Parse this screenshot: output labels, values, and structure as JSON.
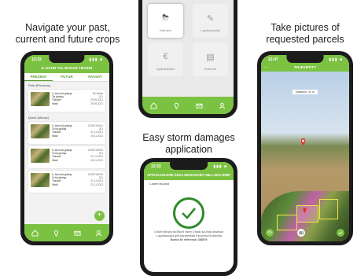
{
  "captions": {
    "left": "Navigate your past,\ncurrent and future crops",
    "center": "Easy storm damages\napplication",
    "right": "Take pictures of\nrequested parcels"
  },
  "colors": {
    "accent": "#7cc242",
    "accent_dark": "#5a9a2a"
  },
  "phone1": {
    "time": "13:32",
    "status_icons": "▮▮▮ ■",
    "header": "IL-UCUR TAL-BAHAR TIKOUN",
    "tabs": [
      "PREZENT",
      "FUTUR",
      "PASSAT"
    ],
    "sections": [
      {
        "title": "Field (Previous)",
        "cards": [
          {
            "name": "IL-Isem tal-ghalqa",
            "value": "Tal Ziebel",
            "rows": [
              "Tal-ghalqa",
              "Tkaswel",
              "Wasil"
            ],
            "right": [
              "G/1",
              "29.05.2021",
              "29.05.2021"
            ]
          }
        ]
      },
      {
        "title": "Quick (Mouse)",
        "cards": [
          {
            "name": "IL-Isem tal-ghalqa",
            "value": "12387/10/001",
            "rows": [
              "Ta tal-ghalqa",
              "Tkaswel",
              "Wasil"
            ],
            "right": [
              "G/1",
              "01.11.2021",
              "15.11.2021"
            ]
          },
          {
            "name": "IL-Isem tal-ghalqa",
            "value": "12387/10/002",
            "rows": [
              "Ta tal-ghalqa",
              "Tkaswel",
              "Wasil"
            ],
            "right": [
              "G/1",
              "01.11.2021",
              "18.11.2021"
            ]
          },
          {
            "name": "IL-Isem tal-ghalqa",
            "value": "12387/10/003",
            "rows": [
              "Ta tal-ghalqa",
              "Tkaswel",
              "Wasil"
            ],
            "right": [
              "G/1",
              "01.11.2021",
              "21.11.2021"
            ]
          }
        ]
      }
    ],
    "fab": "+"
  },
  "phone2": {
    "tiles": [
      {
        "label": "",
        "icon": "cloud-icon"
      },
      {
        "label": "",
        "icon": "pen-icon"
      },
      {
        "label": "Maltempat",
        "icon": "cloud-storm-icon"
      },
      {
        "label": "L-applikazzjonijiet",
        "icon": "pen-icon"
      },
      {
        "label": "Applikazzjonijiet",
        "icon": "money-icon"
      },
      {
        "label": "Dokumenti",
        "icon": "document-icon"
      }
    ]
  },
  "phone3": {
    "time": "13:47",
    "header": "RILIEVIFOTT",
    "distance": "Distance: 31 m"
  },
  "phone4": {
    "time": "13:32",
    "header": "APPLIKAZZJONI GHAL MGHANIJIET MILL-MALTEMP",
    "subtitle": "L-isem tal-post",
    "body_line1": "Il-ħlaħi ħlieqha tal-Ħaunt t'isem il-ħadd sal-ħlas diwwinjat",
    "body_line2": "L-applikazzjoni ġiet ippreżentata b'suċċess lill-awtorita",
    "body_line3": "Numru ta' referenza: 236879"
  }
}
